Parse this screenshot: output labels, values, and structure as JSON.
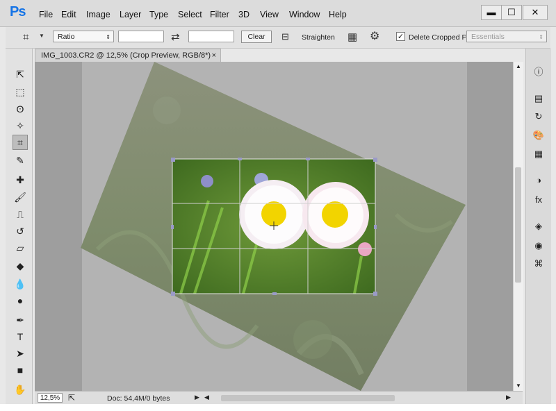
{
  "app": {
    "logo": "Ps"
  },
  "menu": [
    "File",
    "Edit",
    "Image",
    "Layer",
    "Type",
    "Select",
    "Filter",
    "3D",
    "View",
    "Window",
    "Help"
  ],
  "window_controls": {
    "minimize": "▬",
    "maximize": "☐",
    "close": "✕"
  },
  "options": {
    "ratio_select": "Ratio",
    "width_value": "",
    "height_value": "",
    "swap_glyph": "⇄",
    "clear_label": "Clear",
    "straighten_label": "Straighten",
    "delete_cropped_label": "Delete Cropped Pix",
    "delete_cropped_checked": true,
    "workspace_select": "Essentials"
  },
  "document": {
    "tab_title": "IMG_1003.CR2 @ 12,5% (Crop Preview, RGB/8*)",
    "tab_close": "×"
  },
  "status": {
    "zoom": "12,5%",
    "doc_info": "Doc: 54,4M/0 bytes"
  },
  "icons": {
    "tools": [
      "move-icon",
      "marquee-icon",
      "lasso-icon",
      "quick-select-icon",
      "crop-icon",
      "eyedropper-icon",
      "healing-icon",
      "brush-icon",
      "clone-stamp-icon",
      "history-brush-icon",
      "eraser-icon",
      "paint-bucket-icon",
      "blur-icon",
      "dodge-icon",
      "pen-icon",
      "type-icon",
      "path-select-icon",
      "rectangle-icon",
      "hand-icon"
    ],
    "panels": [
      "info-icon",
      "histogram-icon",
      "history-icon",
      "swatches-icon",
      "grid-icon",
      "adjustments-icon",
      "styles-icon",
      "layers-icon",
      "channels-icon",
      "paths-icon"
    ]
  },
  "tool_glyphs": [
    "⇱",
    "⬚",
    "ʘ",
    "✧",
    "⌗",
    "✎",
    "✚",
    "🖌",
    "⎍",
    "↺",
    "▱",
    "◆",
    "💧",
    "●",
    "✒",
    "T",
    "➤",
    "■",
    "✋"
  ],
  "panel_glyphs": [
    "ⓘ",
    "▤",
    "↻",
    "🎨",
    "▦",
    "◑",
    "fx",
    "◈",
    "◉",
    "⌘"
  ],
  "colors": {
    "accent": "#1473e6",
    "crop_grid": "#d0d0d0"
  }
}
